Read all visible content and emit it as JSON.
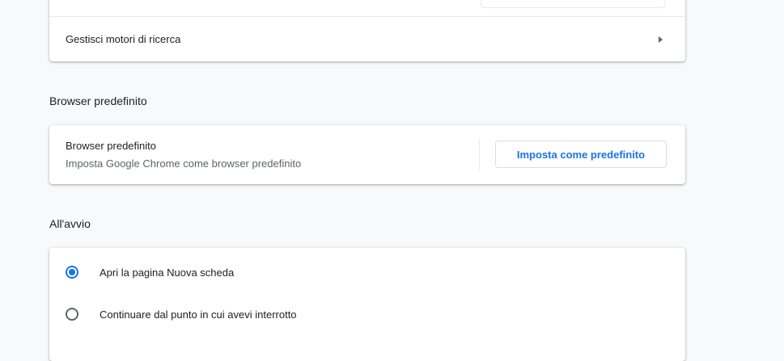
{
  "search_engine_section": {
    "manage_label": "Gestisci motori di ricerca"
  },
  "default_browser_section": {
    "title": "Browser predefinito",
    "row_primary": "Browser predefinito",
    "row_secondary": "Imposta Google Chrome come browser predefinito",
    "button_label": "Imposta come predefinito"
  },
  "startup_section": {
    "title": "All'avvio",
    "options": [
      {
        "label": "Apri la pagina Nuova scheda",
        "selected": true
      },
      {
        "label": "Continuare dal punto in cui avevi interrotto",
        "selected": false
      }
    ]
  },
  "colors": {
    "accent": "#1a73e8",
    "background": "#f8f9fa",
    "card": "#ffffff",
    "secondary_text": "#5f6368"
  }
}
